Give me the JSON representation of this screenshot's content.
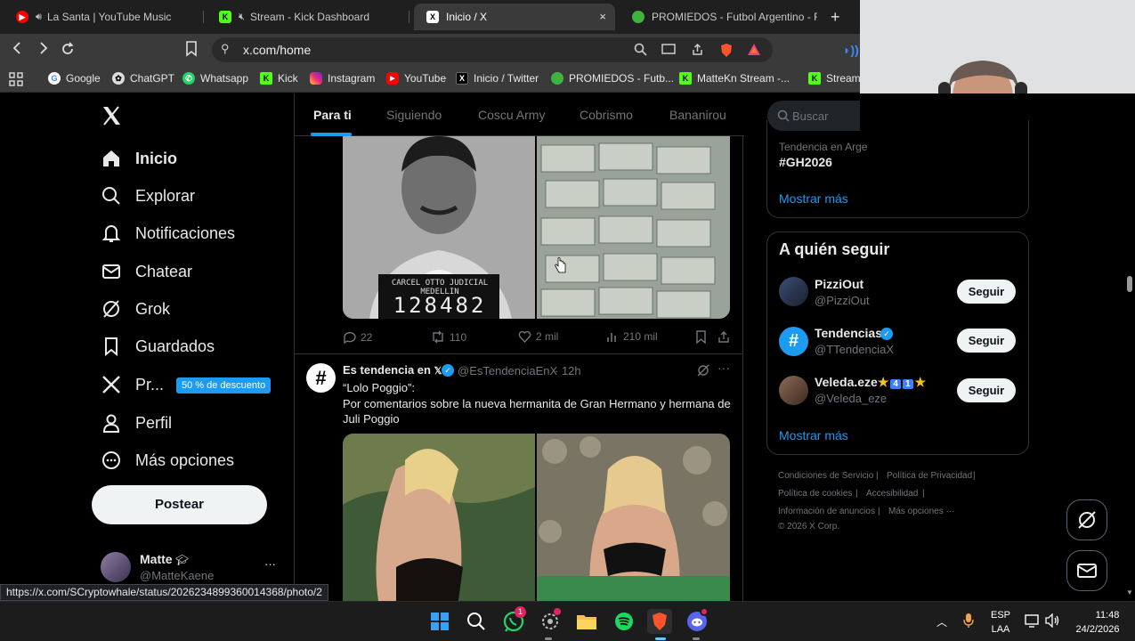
{
  "browser": {
    "tabs": [
      {
        "title": "La Santa | YouTube Music",
        "favicon_color": "#ff0000"
      },
      {
        "title": "Stream - Kick Dashboard",
        "favicon_color": "#53fc18"
      },
      {
        "title": "Inicio / X",
        "favicon_color": "#ffffff"
      },
      {
        "title": "PROMIEDOS - Futbol Argentino - Fixt",
        "favicon_color": "#3fb23f"
      }
    ],
    "new_tab": "+",
    "close": "×",
    "url": "x.com/home",
    "bookmarks": [
      {
        "label": "Google",
        "icon": "google-icon"
      },
      {
        "label": "ChatGPT",
        "icon": "chatgpt-icon"
      },
      {
        "label": "Whatsapp",
        "icon": "whatsapp-icon"
      },
      {
        "label": "Kick",
        "icon": "kick-icon"
      },
      {
        "label": "Instagram",
        "icon": "instagram-icon"
      },
      {
        "label": "YouTube",
        "icon": "youtube-icon"
      },
      {
        "label": "Inicio / Twitter",
        "icon": "x-icon"
      },
      {
        "label": "PROMIEDOS - Futb...",
        "icon": "promiedos-icon"
      },
      {
        "label": "MatteKn Stream -...",
        "icon": "kick-icon"
      },
      {
        "label": "Stream",
        "icon": "kick-icon"
      }
    ]
  },
  "sidebar": {
    "items": [
      {
        "label": "Inicio",
        "icon": "home-icon"
      },
      {
        "label": "Explorar",
        "icon": "search-icon"
      },
      {
        "label": "Notificaciones",
        "icon": "bell-icon"
      },
      {
        "label": "Chatear",
        "icon": "mail-icon"
      },
      {
        "label": "Grok",
        "icon": "grok-icon"
      },
      {
        "label": "Guardados",
        "icon": "bookmark-icon"
      },
      {
        "label": "Pr...",
        "icon": "x-premium-icon"
      },
      {
        "label": "Perfil",
        "icon": "person-icon"
      },
      {
        "label": "Más opciones",
        "icon": "more-circle-icon"
      }
    ],
    "premium_badge": "50 % de descuento",
    "post_button": "Postear",
    "account": {
      "name": "Matte",
      "handle": "@MatteKaene",
      "more": "···"
    }
  },
  "feed": {
    "tabs": [
      "Para ti",
      "Siguiendo",
      "Coscu Army",
      "Cobrismo",
      "Bananirou"
    ],
    "post1": {
      "mugshot_text": "CARCEL OTTO JUDICIAL MEDELLIN",
      "mugshot_number": "128482",
      "replies": "22",
      "reposts": "110",
      "likes": "2 mil",
      "views": "210 mil"
    },
    "post2": {
      "author": "Es tendencia en",
      "handle": "@EsTendenciaEnX",
      "time": "· 12h",
      "avatar": "#",
      "line1": "“Lolo Poggio”:",
      "line2": "Por comentarios sobre la nueva hermanita de Gran Hermano y hermana de Juli Poggio"
    }
  },
  "right": {
    "search_placeholder": "Buscar",
    "trend_context": "Tendencia en Arge",
    "trend": "#GH2026",
    "show_more": "Mostrar más",
    "who_to_follow_title": "A quién seguir",
    "follow_label": "Seguir",
    "suggestions": [
      {
        "name": "PizziOut",
        "handle": "@PizziOut"
      },
      {
        "name": "Tendencias",
        "handle": "@TTendenciaX"
      },
      {
        "name": "Veleda.eze",
        "handle": "@Veleda_eze"
      }
    ],
    "veleda_badges": [
      "4",
      "1"
    ],
    "show_more_2": "Mostrar más",
    "footer": {
      "terms": "Condiciones de Servicio",
      "privacy": "Política de Privacidad",
      "cookies": "Política de cookies",
      "accessibility": "Accesibilidad",
      "ads": "Información de anuncios",
      "more": "Más opciones ···",
      "copyright": "© 2026 X Corp."
    }
  },
  "status_bar_link": "https://x.com/SCryptowhale/status/2026234899360014368/photo/2",
  "taskbar": {
    "language": "ESP",
    "layout": "LAA",
    "time": "11:48",
    "date": "24/2/2026",
    "whatsapp_badge": "1"
  },
  "colors": {
    "accent": "#1d9bf0",
    "background": "#000000",
    "text": "#e7e9ea",
    "muted": "#71767b",
    "border": "#2f3336"
  }
}
